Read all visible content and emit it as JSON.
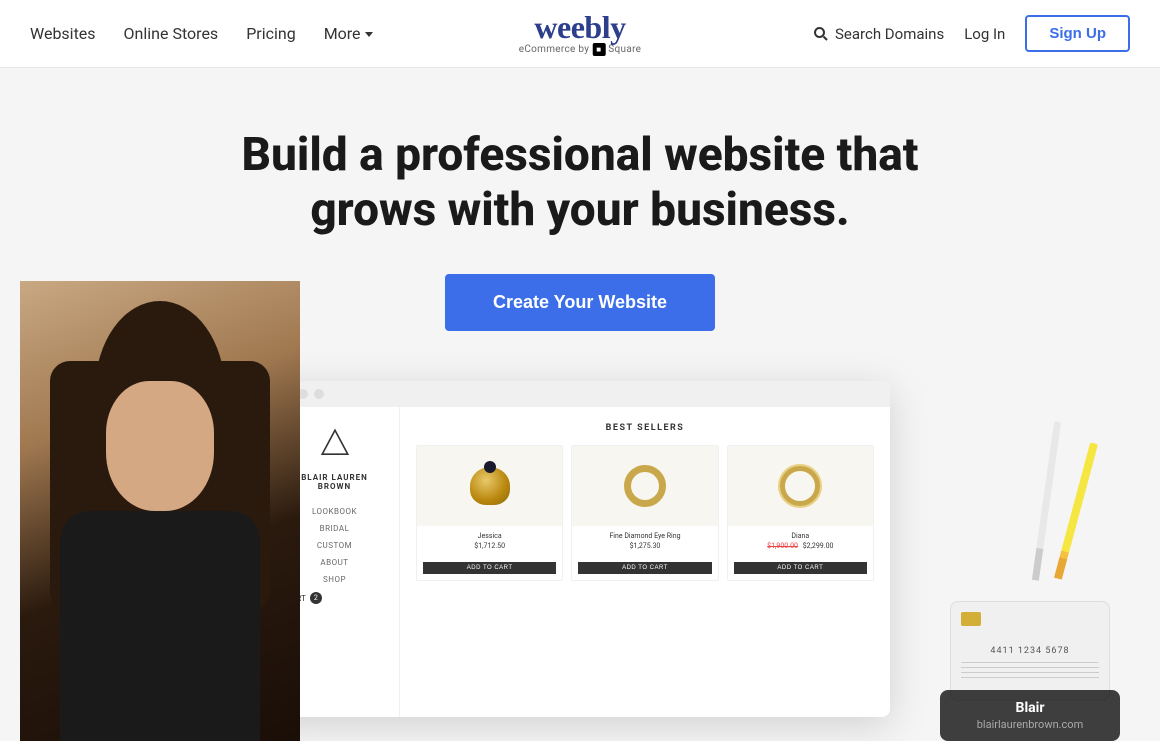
{
  "navbar": {
    "links": [
      {
        "label": "Websites",
        "id": "websites"
      },
      {
        "label": "Online Stores",
        "id": "online-stores"
      },
      {
        "label": "Pricing",
        "id": "pricing"
      },
      {
        "label": "More",
        "id": "more"
      }
    ],
    "logo": {
      "text": "weebly",
      "subtext": "eCommerce by",
      "square_label": "■"
    },
    "search_domains_label": "Search Domains",
    "login_label": "Log In",
    "signup_label": "Sign Up"
  },
  "hero": {
    "title": "Build a professional website that grows with your business.",
    "cta_label": "Create Your Website"
  },
  "mock_site": {
    "store_name": "BLAIR LAUREN BROWN",
    "nav_items": [
      "LOOKBOOK",
      "BRIDAL",
      "CUSTOM",
      "ABOUT",
      "SHOP"
    ],
    "cart_label": "CART",
    "cart_count": "2",
    "section_title": "BEST SELLERS",
    "products": [
      {
        "name": "Jessica",
        "price": "$1,712.50",
        "sale_price": null,
        "original_price": null,
        "btn_label": "ADD TO CART"
      },
      {
        "name": "Fine Diamond Eye Ring",
        "price": "$1,275.30",
        "sale_price": null,
        "original_price": null,
        "btn_label": "ADD TO CART"
      },
      {
        "name": "Diana",
        "price": "$2,299.00",
        "sale_price": "$1,900.00",
        "original_price": "$2,299.00",
        "btn_label": "ADD TO CART"
      }
    ]
  },
  "blair_popup": {
    "name": "Blair",
    "url": "blairlaurenbrown.com"
  },
  "colors": {
    "accent": "#3b6ee8",
    "logo_color": "#2c3e8c"
  }
}
